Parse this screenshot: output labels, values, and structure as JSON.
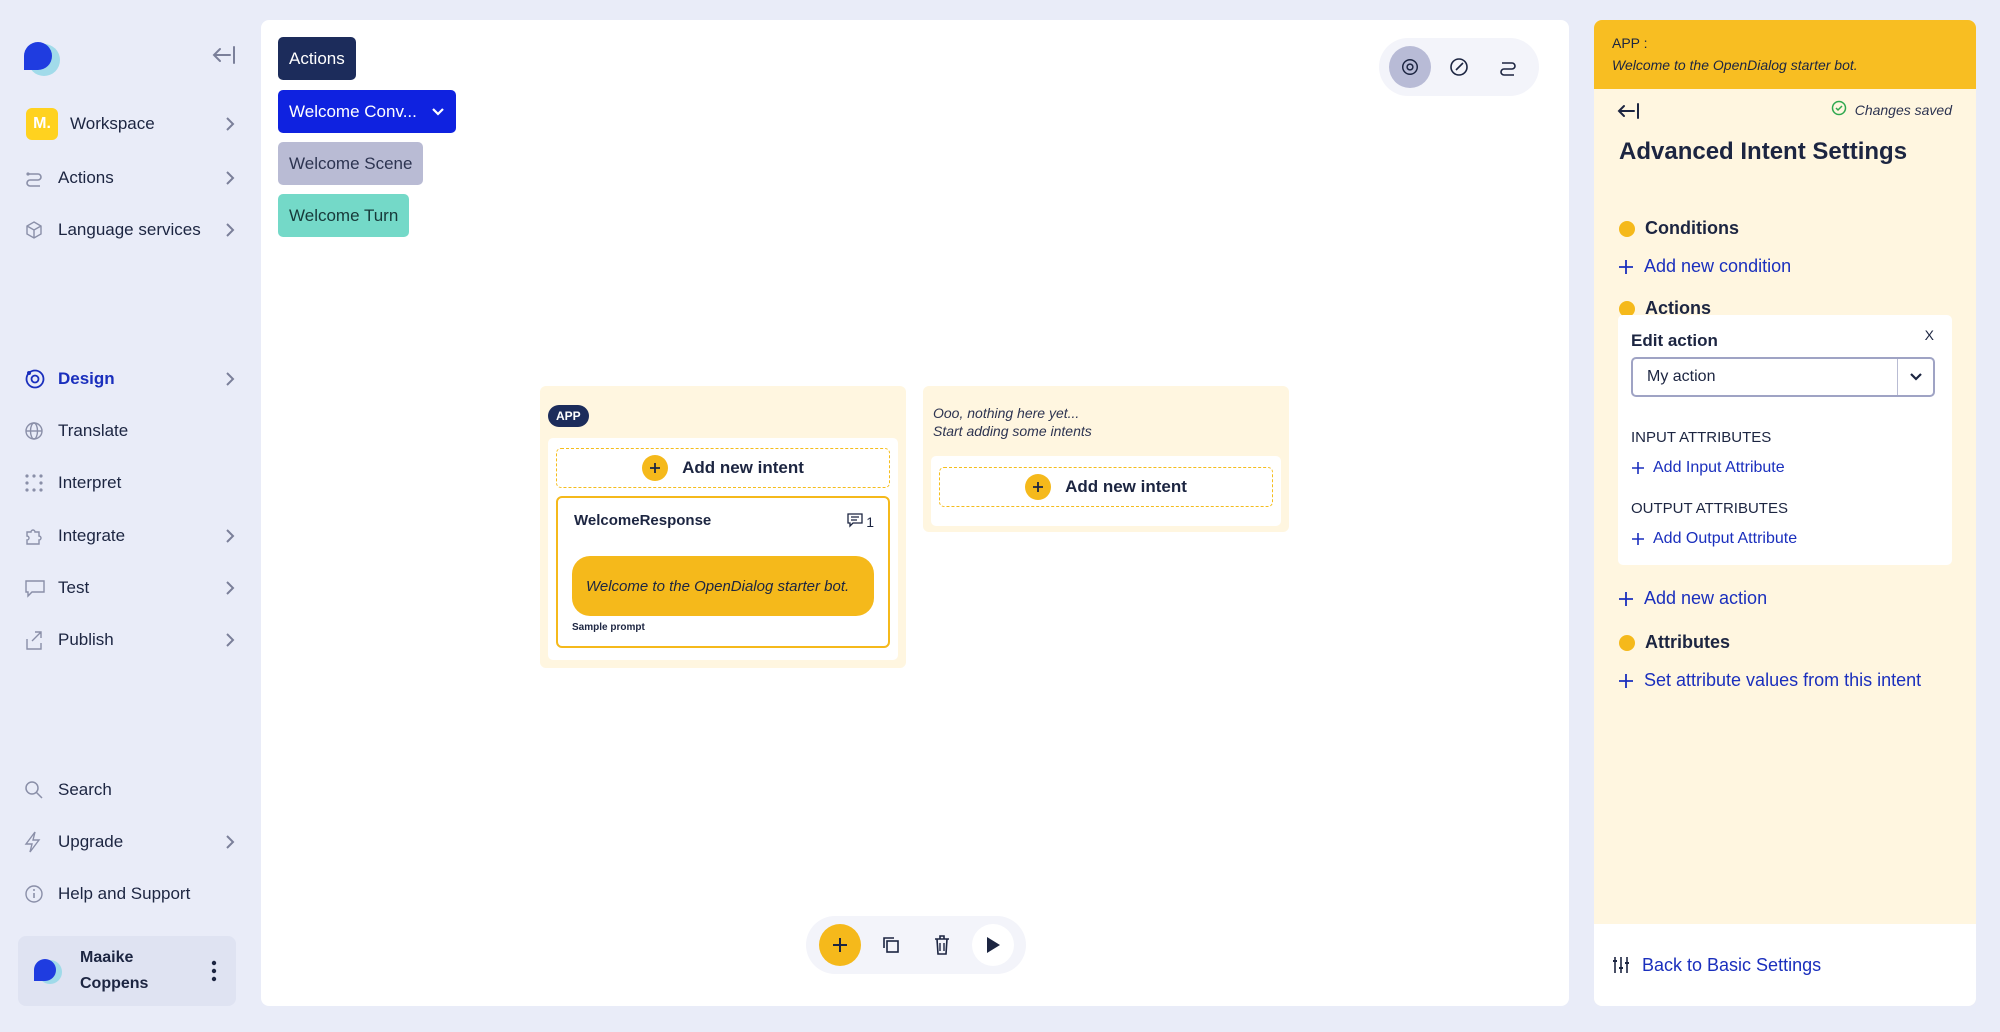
{
  "sidebar": {
    "workspace_badge": "M.",
    "items_top": [
      {
        "label": "Workspace"
      },
      {
        "label": "Actions"
      },
      {
        "label": "Language services"
      }
    ],
    "items_mid": [
      {
        "label": "Design"
      },
      {
        "label": "Translate"
      },
      {
        "label": "Interpret"
      },
      {
        "label": "Integrate"
      },
      {
        "label": "Test"
      },
      {
        "label": "Publish"
      }
    ],
    "items_bottom": [
      {
        "label": "Search"
      },
      {
        "label": "Upgrade"
      },
      {
        "label": "Help and Support"
      }
    ],
    "user": {
      "first": "Maaike",
      "last": "Coppens"
    }
  },
  "breadcrumbs": {
    "actions": "Actions",
    "conversation": "Welcome Conv...",
    "scene": "Welcome Scene",
    "turn": "Welcome Turn"
  },
  "canvas": {
    "app_column": {
      "pill": "APP",
      "add_intent": "Add new intent",
      "intent": {
        "name": "WelcomeResponse",
        "message_count": "1",
        "message": "Welcome to the OpenDialog starter bot.",
        "sample_label": "Sample prompt"
      }
    },
    "empty_column": {
      "line1": "Ooo, nothing here yet...",
      "line2": "Start adding some intents",
      "add_intent": "Add new intent"
    }
  },
  "panel": {
    "header_type": "APP :",
    "header_desc": "Welcome to the OpenDialog starter bot.",
    "saved": "Changes saved",
    "title": "Advanced Intent Settings",
    "conditions": "Conditions",
    "add_condition": "Add new condition",
    "actions": "Actions",
    "edit_action": {
      "title": "Edit action",
      "close": "X",
      "selected": "My action",
      "input_head": "INPUT ATTRIBUTES",
      "add_input": "Add Input Attribute",
      "output_head": "OUTPUT ATTRIBUTES",
      "add_output": "Add Output Attribute"
    },
    "add_action": "Add new action",
    "attributes": "Attributes",
    "set_attributes": "Set attribute values from this intent",
    "back_basic": "Back to Basic Settings"
  },
  "colors": {
    "accent_yellow": "#f5b91b",
    "brand_blue": "#1a2fbd",
    "navy": "#1c2c5b",
    "conv_blue": "#0f22e0",
    "scene_grey": "#b9bbd4",
    "turn_teal": "#74d9c8"
  }
}
